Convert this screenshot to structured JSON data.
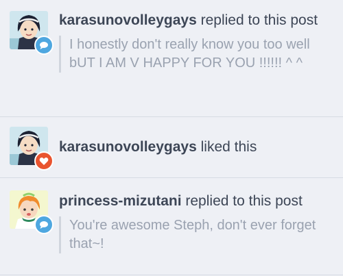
{
  "notes": [
    {
      "username": "karasunovolleygays",
      "action": " replied to this post",
      "reply_text": "I honestly don't really know you too well   bUT I AM V HAPPY FOR YOU !!!!!! ^ ^",
      "badge": {
        "type": "reply",
        "icon": "chat-bubble-icon",
        "color": "#4ea7e0"
      }
    },
    {
      "username": "karasunovolleygays",
      "action": " liked this",
      "badge": {
        "type": "like",
        "icon": "heart-icon",
        "color": "#e9542f"
      }
    },
    {
      "username": "princess-mizutani",
      "action": " replied to this post",
      "reply_text": "You're awesome Steph, don't ever forget that~!",
      "badge": {
        "type": "reply",
        "icon": "chat-bubble-icon",
        "color": "#4ea7e0"
      }
    }
  ]
}
